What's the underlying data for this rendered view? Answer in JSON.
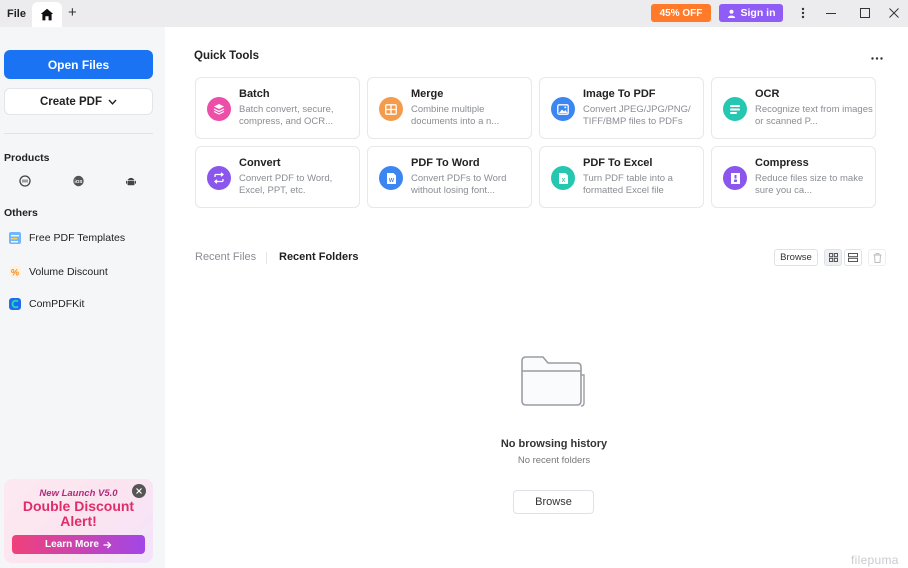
{
  "titlebar": {
    "file_menu": "File",
    "promo_badge": "45% OFF",
    "signin_label": "Sign in"
  },
  "sidebar": {
    "open_files": "Open Files",
    "create_pdf": "Create PDF",
    "products_heading": "Products",
    "platforms": [
      "mac-icon",
      "ios-icon",
      "android-icon"
    ],
    "others_heading": "Others",
    "others": [
      {
        "label": "Free PDF Templates",
        "icon": "templates-icon"
      },
      {
        "label": "Volume Discount",
        "icon": "percent-icon"
      },
      {
        "label": "ComPDFKit",
        "icon": "compdfkit-icon"
      }
    ],
    "promo": {
      "line1": "New Launch V5.0",
      "line2a": "Double Discount",
      "line2b": "Alert!",
      "learn_more": "Learn More"
    }
  },
  "quick_tools": {
    "title": "Quick Tools",
    "tools": [
      {
        "name": "Batch",
        "desc": "Batch convert, secure, compress, and OCR...",
        "color": "#ec4fa7",
        "icon": "layers-icon"
      },
      {
        "name": "Merge",
        "desc": "Combine multiple documents into a n...",
        "color": "#f49b4c",
        "icon": "merge-icon"
      },
      {
        "name": "Image To PDF",
        "desc": "Convert JPEG/JPG/PNG/ TIFF/BMP files to PDFs",
        "color": "#3b86f0",
        "icon": "image-icon"
      },
      {
        "name": "OCR",
        "desc": "Recognize text from images or scanned P...",
        "color": "#25c7b1",
        "icon": "ocr-icon"
      },
      {
        "name": "Convert",
        "desc": "Convert PDF to Word, Excel, PPT, etc.",
        "color": "#8a56ec",
        "icon": "convert-icon"
      },
      {
        "name": "PDF To Word",
        "desc": "Convert PDFs to Word without losing font...",
        "color": "#3b86f0",
        "icon": "word-icon"
      },
      {
        "name": "PDF To Excel",
        "desc": "Turn PDF table into a formatted Excel file",
        "color": "#25c7b1",
        "icon": "excel-icon"
      },
      {
        "name": "Compress",
        "desc": "Reduce files size to make sure you ca...",
        "color": "#8a56ec",
        "icon": "compress-icon"
      }
    ]
  },
  "recent": {
    "tab_files": "Recent Files",
    "tab_folders": "Recent Folders",
    "browse_small": "Browse",
    "empty_title": "No browsing history",
    "empty_sub": "No recent folders",
    "browse_big": "Browse"
  },
  "watermark": "filepuma"
}
